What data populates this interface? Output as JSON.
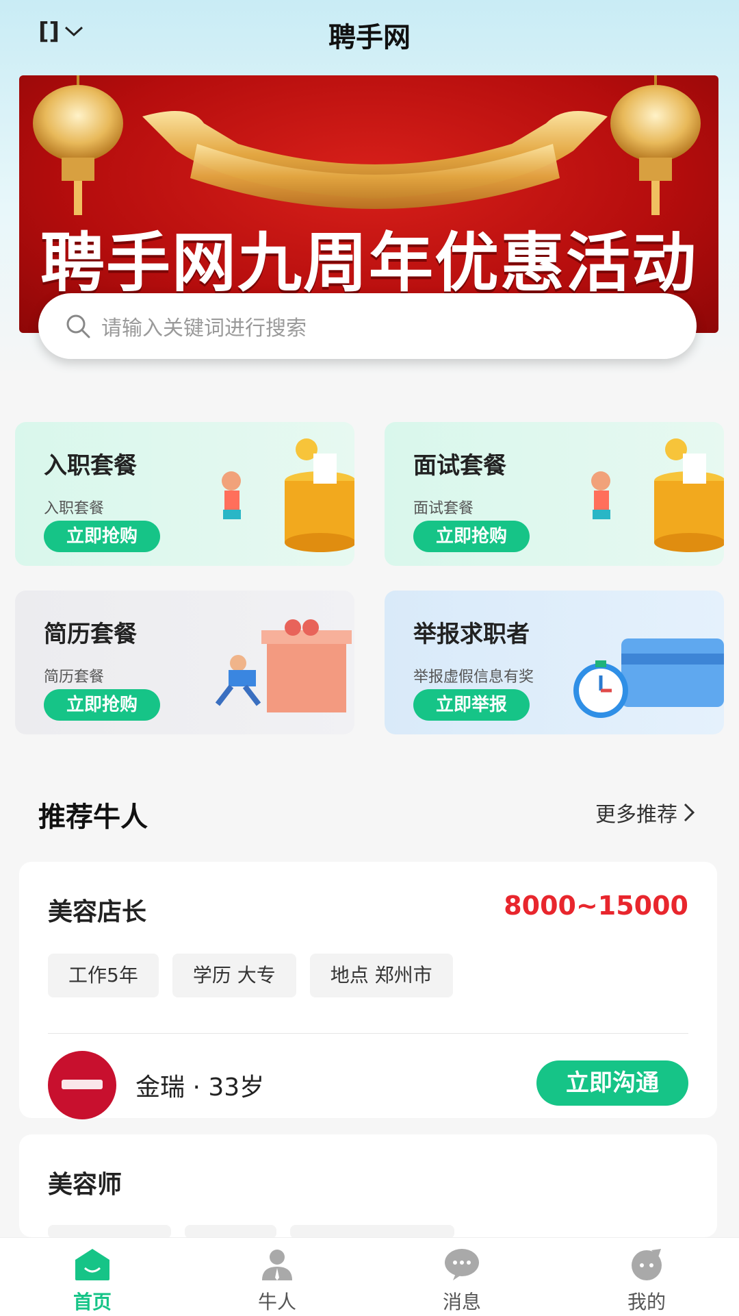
{
  "header": {
    "location_label": "[]",
    "title": "聘手网"
  },
  "banner": {
    "headline": "聘手网九周年优惠活动"
  },
  "search": {
    "placeholder": "请输入关键词进行搜索"
  },
  "promo_cards": [
    {
      "title": "入职套餐",
      "subtitle": "入职套餐",
      "button": "立即抢购"
    },
    {
      "title": "面试套餐",
      "subtitle": "面试套餐",
      "button": "立即抢购"
    },
    {
      "title": "简历套餐",
      "subtitle": "简历套餐",
      "button": "立即抢购"
    },
    {
      "title": "举报求职者",
      "subtitle": "举报虚假信息有奖",
      "button": "立即举报"
    }
  ],
  "recommend": {
    "title": "推荐牛人",
    "more": "更多推荐"
  },
  "candidates": [
    {
      "job": "美容店长",
      "salary": "8000~15000",
      "tags": [
        "工作5年",
        "学历 大专",
        "地点 郑州市"
      ],
      "name_age": "金瑞 · 33岁",
      "button": "立即沟通"
    },
    {
      "job": "美容师"
    }
  ],
  "tabbar": [
    {
      "label": "首页",
      "icon": "home-icon",
      "active": true
    },
    {
      "label": "牛人",
      "icon": "person-icon",
      "active": false
    },
    {
      "label": "消息",
      "icon": "message-icon",
      "active": false
    },
    {
      "label": "我的",
      "icon": "profile-icon",
      "active": false
    }
  ],
  "colors": {
    "accent_green": "#16c487",
    "salary_red": "#e8262d",
    "banner_red": "#c8150f"
  }
}
